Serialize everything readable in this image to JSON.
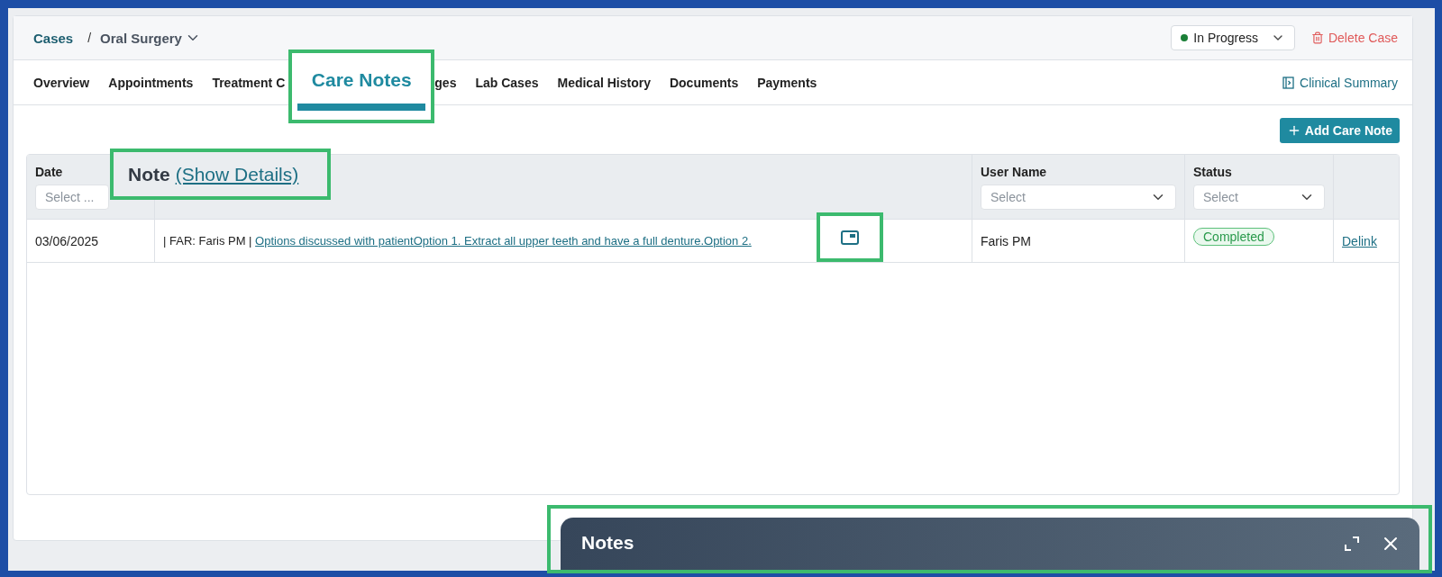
{
  "breadcrumb": {
    "root": "Cases",
    "separator": "/",
    "current": "Oral Surgery"
  },
  "status_select": {
    "value": "In Progress",
    "color": "#1a7f37"
  },
  "delete_button": "Delete Case",
  "tabs": [
    {
      "label": "Overview",
      "selected": false
    },
    {
      "label": "Appointments",
      "selected": false
    },
    {
      "label": "Treatment C",
      "selected": false
    },
    {
      "label": "Care Notes",
      "selected": true
    },
    {
      "label": "ges",
      "selected": false
    },
    {
      "label": "Lab Cases",
      "selected": false
    },
    {
      "label": "Medical History",
      "selected": false
    },
    {
      "label": "Documents",
      "selected": false
    },
    {
      "label": "Payments",
      "selected": false
    }
  ],
  "clinical_summary": "Clinical Summary",
  "add_button": "Add Care Note",
  "table": {
    "columns": [
      {
        "label": "Date",
        "placeholder": "Select ..."
      },
      {
        "label": "Note",
        "link": "(Show Details)"
      },
      {
        "label": "User Name",
        "placeholder": "Select"
      },
      {
        "label": "Status",
        "placeholder": "Select"
      }
    ],
    "rows": [
      {
        "date": "03/06/2025",
        "note_prefix": "| FAR: Faris PM |",
        "note_link": "Options discussed with patientOption 1. Extract all upper teeth and have a full denture.Option 2.",
        "user": "Faris PM",
        "status": "Completed",
        "action": "Delink"
      }
    ]
  },
  "notes_panel": {
    "title": "Notes"
  }
}
